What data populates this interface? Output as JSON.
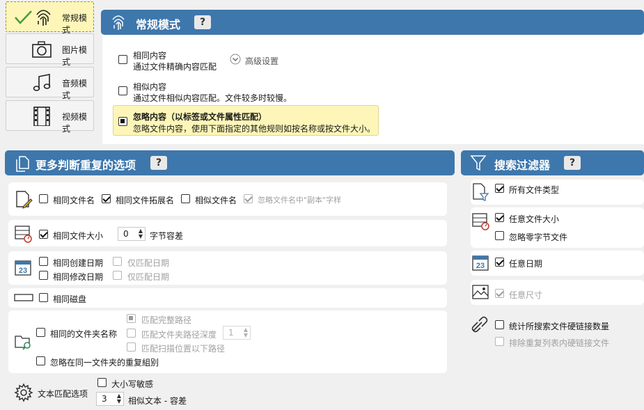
{
  "modes": [
    {
      "label": "常规模式",
      "icon": "fingerprint-icon",
      "active": true
    },
    {
      "label": "图片模式",
      "icon": "camera-icon",
      "active": false
    },
    {
      "label": "音频模式",
      "icon": "music-note-icon",
      "active": false
    },
    {
      "label": "视频模式",
      "icon": "film-icon",
      "active": false
    }
  ],
  "normal": {
    "title": "常规模式",
    "help": "?",
    "same_content": {
      "title": "相同内容",
      "desc": "通过文件精确内容匹配"
    },
    "advanced": "高级设置",
    "similar_content": {
      "title": "相似内容",
      "desc": "通过文件相似内容匹配。文件较多时较慢。"
    },
    "ignore_content": {
      "title": "忽略内容（以标签或文件属性匹配）",
      "desc": "忽略文件内容，使用下面指定的其他规则如按名称或按文件大小。"
    }
  },
  "options": {
    "title": "更多判断重复的选项",
    "help": "?",
    "same_name": "相同文件名",
    "same_ext": "相同文件拓展名",
    "similar_name": "相似文件名",
    "ignore_copy": "忽略文件名中\"副本\"字样",
    "same_size": "相同文件大小",
    "size_tolerance": "0",
    "byte_tolerance": "字节容差",
    "same_created": "相同创建日期",
    "same_modified": "相同修改日期",
    "date_only_1": "仅匹配日期",
    "date_only_2": "仅匹配日期",
    "same_disk": "相同磁盘",
    "same_folder": "相同的文件夹名称",
    "match_full_path": "匹配完整路径",
    "match_depth": "匹配文件夹路径深度",
    "depth_value": "1",
    "match_below": "匹配扫描位置以下路径",
    "ignore_same_folder": "忽略在同一文件夹的重复組别",
    "text_options": "文本匹配选项",
    "case_sensitive": "大小写敏感",
    "text_tolerance_value": "3",
    "text_tolerance": "相似文本 - 容差"
  },
  "filters": {
    "title": "搜索过滤器",
    "help": "?",
    "all_types": "所有文件类型",
    "any_size": "任意文件大小",
    "ignore_zero": "忽略零字节文件",
    "any_date": "任意日期",
    "any_dimension": "任意尺寸",
    "hardlinks": "统计所搜索文件硬链接数量",
    "exclude_hardlinks": "排除重复列表内硬链接文件"
  },
  "colors": {
    "header": "#3e77ac",
    "active_mode": "#fdf6b8",
    "highlight": "#fdf6b8"
  }
}
